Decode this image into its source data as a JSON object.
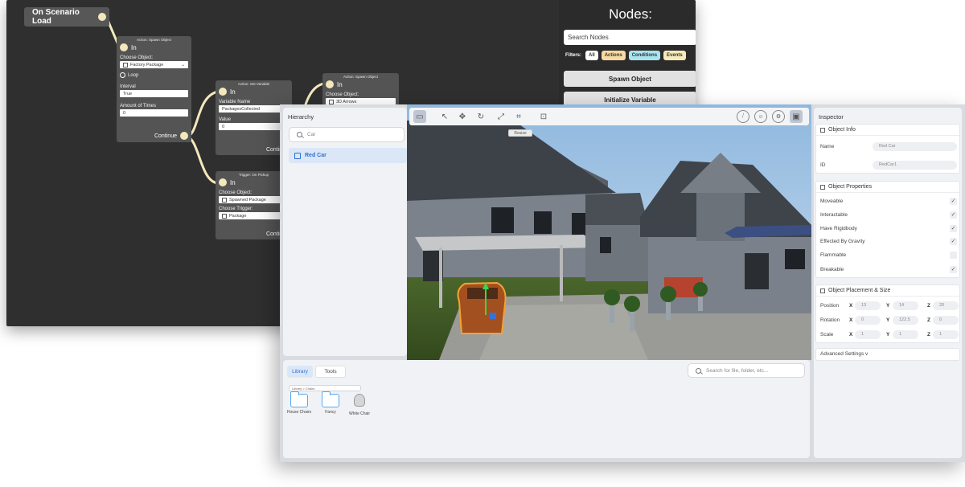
{
  "node_editor": {
    "start_node": "On Scenario Load",
    "nodes_panel": {
      "title": "Nodes:",
      "search_placeholder": "Search Nodes",
      "filters_label": "Filters:",
      "filters": [
        {
          "label": "All",
          "color": "#ffffff"
        },
        {
          "label": "Actions",
          "color": "#f8d9a1"
        },
        {
          "label": "Conditions",
          "color": "#a8e3f0"
        },
        {
          "label": "Events",
          "color": "#f6ebb9"
        }
      ],
      "buttons": [
        "Spawn Object",
        "Initialize Variable"
      ]
    },
    "spawn_node": {
      "title": "Action: Spawn Object",
      "in_label": "In",
      "choose_label": "Choose Object:",
      "object": "Factory Package",
      "loop_label": "Loop",
      "interval_label": "Interval",
      "interval": "True",
      "amount_label": "Amount of Times",
      "amount": "0",
      "continue_label": "Continue"
    },
    "set_var_node": {
      "title": "Action: Set Variable",
      "in_label": "In",
      "var_name_label": "Variable Name",
      "var_name": "PackagesCollected",
      "value_label": "Value",
      "value": "0",
      "continue_label": "Continue"
    },
    "trigger_node": {
      "title": "Trigger: On Pickup",
      "in_label": "In",
      "choose_label": "Choose Object:",
      "object": "Spawned Package",
      "trigger_label": "Choose Trigger:",
      "trigger": "Package",
      "continue_label": "Continue"
    },
    "spawn_node_2": {
      "title": "Action: Spawn Object",
      "in_label": "In",
      "choose_label": "Choose Object:",
      "object": "3D Arrows"
    }
  },
  "editor": {
    "hierarchy": {
      "title": "Hierarchy",
      "search_value": "Car",
      "items": [
        "Red Car"
      ]
    },
    "viewport": {
      "resize_tooltip": "Resize"
    },
    "bottom": {
      "tabs": [
        "Library",
        "Tools"
      ],
      "search_placeholder": "Search for file, folder, etc...",
      "breadcrumb": "Library > Chairs",
      "assets": [
        "House Chairs",
        "Fancy",
        "White Chair"
      ]
    },
    "inspector": {
      "title": "Inspector",
      "object_info": {
        "header": "Object Info",
        "name_label": "Name",
        "name_value": "Red Car",
        "id_label": "ID",
        "id_value": "RedCar1"
      },
      "properties": {
        "header": "Object Properties",
        "items": [
          {
            "label": "Moveable",
            "checked": true
          },
          {
            "label": "Interactable",
            "checked": true
          },
          {
            "label": "Have Rigidbody",
            "checked": true
          },
          {
            "label": "Effected By Gravity",
            "checked": true
          },
          {
            "label": "Flammable",
            "checked": false
          },
          {
            "label": "Breakable",
            "checked": true
          }
        ]
      },
      "placement": {
        "header": "Object Placement & Size",
        "position_label": "Position",
        "rotation_label": "Rotation",
        "scale_label": "Scale",
        "x": "X",
        "y": "Y",
        "z": "Z",
        "position": [
          "13",
          "14",
          "20"
        ],
        "rotation": [
          "0",
          "122.5",
          "0"
        ],
        "scale": [
          "1",
          "1",
          "1"
        ]
      },
      "advanced_label": "Advanced Settings v"
    }
  }
}
